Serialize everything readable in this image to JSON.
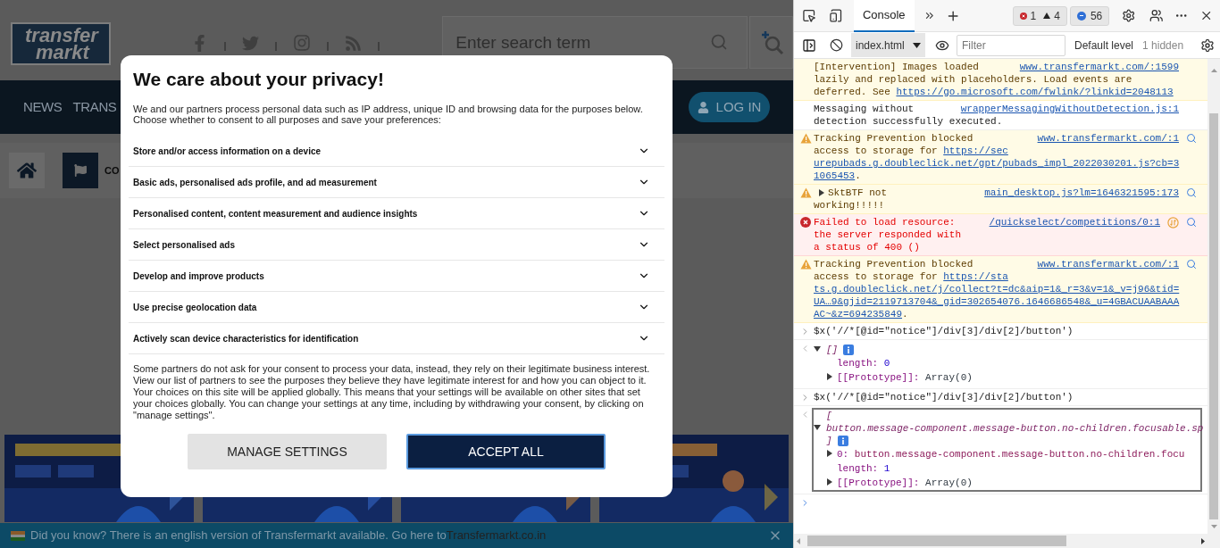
{
  "page": {
    "logo": {
      "line1": "transfer",
      "line2": "markt"
    },
    "search": {
      "placeholder": "Enter search term"
    },
    "nav": [
      {
        "label": "NEWS"
      },
      {
        "label": "TRANS"
      }
    ],
    "login": "LOG IN",
    "breadcrumb": "CO",
    "banner": {
      "text": "Did you know? There is an english version of Transfermarkt available. Go here to",
      "link": "Transfermarkt.co.in"
    }
  },
  "consent": {
    "title": "We care about your privacy!",
    "intro": "We and our partners process personal data such as IP address, unique ID and browsing data for the purposes below. Choose whether to consent to all purposes and save your preferences:",
    "purposes": [
      {
        "label": "Store and/or access information on a device",
        "expanded": false
      },
      {
        "label": "Basic ads, personalised ads profile, and ad measurement",
        "expanded": false
      },
      {
        "label": "Personalised content, content measurement and audience insights",
        "expanded": false
      },
      {
        "label": "Select personalised ads",
        "expanded": false
      },
      {
        "label": "Develop and improve products",
        "expanded": false
      },
      {
        "label": "Use precise geolocation data",
        "expanded": false
      },
      {
        "label": "Actively scan device characteristics for identification",
        "expanded": false
      }
    ],
    "notes": [
      "Some partners do not ask for your consent to process your data, instead, they rely on their legitimate business interest. View our list of partners to see the purposes they believe they have legitimate interest for and how you can object to it.",
      "Your choices on this site will be applied globally. This means that your settings will be available on other sites that set your choices globally. You can change your settings at any time, including by withdrawing your consent, by clicking on \"manage settings\"."
    ],
    "buttons": [
      {
        "label": "MANAGE SETTINGS",
        "kind": "secondary"
      },
      {
        "label": "ACCEPT ALL",
        "kind": "primary"
      }
    ]
  },
  "devtools": {
    "tabs": [
      {
        "label": "Console",
        "selected": true
      }
    ],
    "counts": {
      "errors": "1",
      "warnings": "4",
      "issues": "56"
    },
    "context": "index.html",
    "filter": {
      "placeholder": "Filter"
    },
    "levels": "Default level",
    "hidden": "1 hidden",
    "messages": [
      {
        "kind": "warning",
        "icon": false,
        "expander": false,
        "search_icon": false,
        "request_icon": false,
        "source": "www.transfermarkt.com/:1599",
        "lines": [
          [
            {
              "text": "[Intervention] Images loaded"
            }
          ],
          [
            {
              "text": "lazily and replaced with placeholders. Load events are"
            }
          ],
          [
            {
              "text": "deferred. See "
            },
            {
              "text": "https://go.microsoft.com/fwlink/?linkid=2048113",
              "link": true
            }
          ]
        ]
      },
      {
        "kind": "info",
        "expander": false,
        "search_icon": false,
        "request_icon": false,
        "source": "wrapperMessagingWithoutDetection.js:1",
        "lines": [
          [
            {
              "text": "Messaging without"
            }
          ],
          [
            {
              "text": "detection successfully executed."
            }
          ]
        ]
      },
      {
        "kind": "warning",
        "icon": true,
        "expander": false,
        "search_icon": true,
        "request_icon": false,
        "source": "www.transfermarkt.com/:1",
        "lines": [
          [
            {
              "text": "Tracking Prevention blocked"
            }
          ],
          [
            {
              "text": "access to storage for "
            },
            {
              "text": "https://sec",
              "link": true
            }
          ],
          [
            {
              "text": "urepubads.g.doubleclick.net/gpt/pubads_impl_2022030201.js?cb=3",
              "link": true
            }
          ],
          [
            {
              "text": "1065453",
              "link": true
            },
            {
              "text": "."
            }
          ]
        ]
      },
      {
        "kind": "warning",
        "icon": true,
        "expander": true,
        "search_icon": true,
        "request_icon": false,
        "source": "main_desktop.js?lm=1646321595:173",
        "lines": [
          [
            {
              "text": "SktBTF not"
            }
          ],
          [
            {
              "text": "working!!!!!"
            }
          ]
        ]
      },
      {
        "kind": "error",
        "icon": true,
        "expander": false,
        "search_icon": true,
        "request_icon": true,
        "source": "/quickselect/competitions/0:1",
        "lines": [
          [
            {
              "text": "Failed to load resource:"
            }
          ],
          [
            {
              "text": "the server responded with"
            }
          ],
          [
            {
              "text": "a status of 400 ()"
            }
          ]
        ]
      },
      {
        "kind": "warning",
        "icon": true,
        "expander": false,
        "search_icon": true,
        "request_icon": false,
        "source": "www.transfermarkt.com/:1",
        "lines": [
          [
            {
              "text": "Tracking Prevention blocked"
            }
          ],
          [
            {
              "text": "access to storage for "
            },
            {
              "text": "https://sta",
              "link": true
            }
          ],
          [
            {
              "text": "ts.g.doubleclick.net/j/collect?t=dc&aip=1&_r=3&v=1&_v=j96&tid=",
              "link": true
            }
          ],
          [
            {
              "text": "UA…9&gjid=2119713704&_gid=302654076.1646686548&_u=4GBACUAABAAA",
              "link": true
            }
          ],
          [
            {
              "text": "AC~&z=694235849",
              "link": true
            },
            {
              "text": "."
            }
          ]
        ]
      },
      {
        "kind": "input",
        "text": "$x('//*[@id=\"notice\"]/div[3]/div[2]/button')"
      },
      {
        "kind": "result",
        "expanded": true,
        "highlighted": false,
        "info_badge": true,
        "summary": [
          "[]"
        ],
        "entries": [
          {
            "kind": "number",
            "key": "length:",
            "value": "0"
          },
          {
            "kind": "object",
            "expanded": false,
            "key": "[[Prototype]]:",
            "value": "Array(0)"
          }
        ]
      },
      {
        "kind": "input",
        "text": "$x('//*[@id=\"notice\"]/div[3]/div[2]/button')"
      },
      {
        "kind": "result",
        "expanded": true,
        "highlighted": true,
        "info_badge": true,
        "summary": [
          "[",
          "button.message-component.message-button.no-children.focusable.sp",
          "]"
        ],
        "entries": [
          {
            "kind": "node",
            "expanded": false,
            "key": "0:",
            "value": "button.message-component.message-button.no-children.focu"
          },
          {
            "kind": "number",
            "key": "length:",
            "value": "1"
          },
          {
            "kind": "object",
            "expanded": false,
            "key": "[[Prototype]]:",
            "value": "Array(0)"
          }
        ]
      },
      {
        "kind": "prompt"
      }
    ]
  }
}
